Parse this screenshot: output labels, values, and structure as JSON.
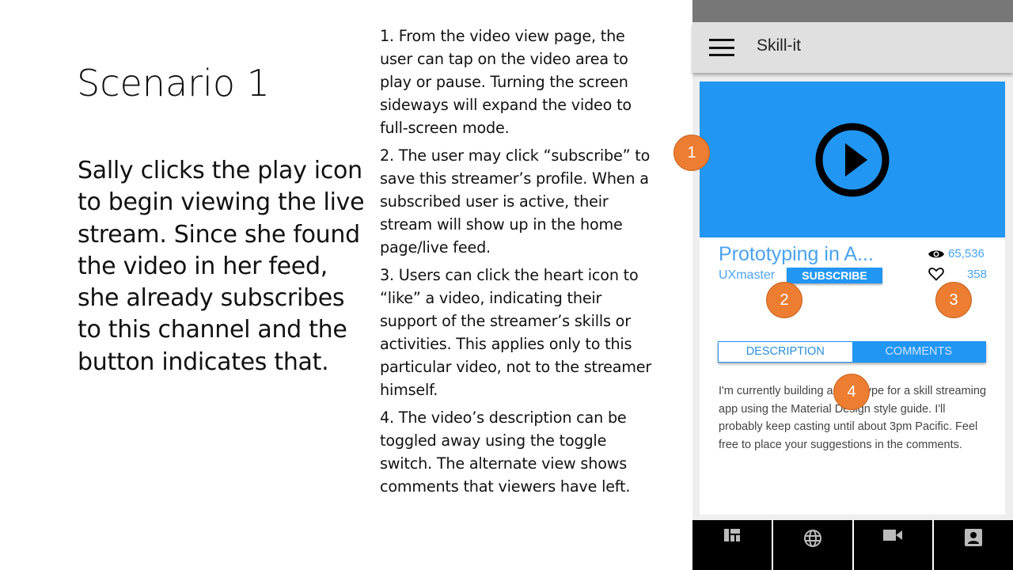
{
  "slide": {
    "title": "Scenario 1",
    "story": "Sally clicks the play icon to begin viewing the live stream. Since she found the video in her feed, she already subscribes to this channel and the button indicates that.",
    "notes": [
      "1. From the video view page, the user can tap on the video area to play or pause. Turning the screen sideways will expand the video to full-screen mode.",
      "2. The user may click “subscribe” to save this streamer’s profile. When a subscribed user is active, their stream will show up in the home page/live feed.",
      "3. Users can click the heart icon to “like” a video, indicating their support of the streamer’s skills or activities. This applies only to this particular video, not to the streamer himself.",
      "4. The video’s description can be toggled away using the toggle switch. The alternate view shows comments that viewers have left."
    ]
  },
  "app": {
    "title": "Skill-it",
    "video_title": "Prototyping in A...",
    "author": "UXmaster",
    "subscribe": "SUBSCRIBE",
    "views": "65,536",
    "likes": "358",
    "tabs": [
      "DESCRIPTION",
      "COMMENTS"
    ],
    "description": "I'm currently building a prototype for a skill streaming app using the Material Design style guide. I'll probably keep casting until about 3pm Pacific. Feel free to place your suggestions in the comments.",
    "nav": [
      "dashboard-icon",
      "globe-icon",
      "video-camera-icon",
      "account-box-icon"
    ]
  },
  "badges": [
    "1",
    "2",
    "3",
    "4"
  ],
  "colors": {
    "accent": "#2196f3",
    "badge": "#ed7d31"
  }
}
